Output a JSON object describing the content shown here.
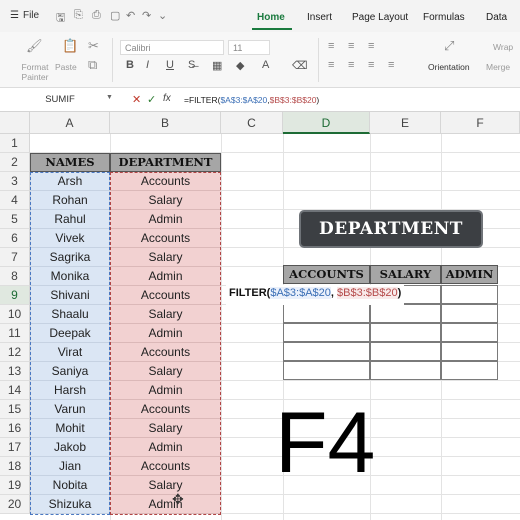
{
  "menu": {
    "file": "File",
    "tabs": [
      "Home",
      "Insert",
      "Page Layout",
      "Formulas",
      "Data"
    ],
    "active_tab": "Home"
  },
  "ribbon": {
    "format_painter": "Format Painter",
    "paste": "Paste",
    "font": "Calibri",
    "size": "11",
    "bold": "B",
    "italic": "I",
    "underline": "U",
    "orientation": "Orientation",
    "wrap": "Wrap",
    "merge": "Merge"
  },
  "formula_bar": {
    "name_box": "SUMIF",
    "fx": "fx",
    "formula_prefix": "=FILTER(",
    "formula_rangeA": "$A$3:$A$20",
    "formula_comma": ",",
    "formula_rangeB": "$B$3:$B$20",
    "formula_suffix": ")"
  },
  "columns": [
    "A",
    "B",
    "C",
    "D",
    "E",
    "F"
  ],
  "rows": [
    "1",
    "2",
    "3",
    "4",
    "5",
    "6",
    "7",
    "8",
    "9",
    "10",
    "11",
    "12",
    "13",
    "14",
    "15",
    "16",
    "17",
    "18",
    "19",
    "20"
  ],
  "table": {
    "headers": [
      "NAMES",
      "DEPARTMENT"
    ],
    "names": [
      "Arsh",
      "Rohan",
      "Rahul",
      "Vivek",
      "Sagrika",
      "Monika",
      "Shivani",
      "Shaalu",
      "Deepak",
      "Virat",
      "Saniya",
      "Harsh",
      "Varun",
      "Mohit",
      "Jakob",
      "Jian",
      "Nobita",
      "Shizuka"
    ],
    "departments": [
      "Accounts",
      "Salary",
      "Admin",
      "Accounts",
      "Salary",
      "Admin",
      "Accounts",
      "Salary",
      "Admin",
      "Accounts",
      "Salary",
      "Admin",
      "Accounts",
      "Salary",
      "Admin",
      "Accounts",
      "Salary",
      "Admin"
    ]
  },
  "banner": "DEPARTMENT",
  "output_headers": [
    "ACCOUNTS",
    "SALARY",
    "ADMIN"
  ],
  "tooltip": {
    "prefix": "FILTER(",
    "rangeA": "$A$3:$A$20",
    "comma": ",",
    "rangeB": "$B$3:$B$20",
    "suffix": ")"
  },
  "overlay_key": "F4",
  "colors": {
    "accent_green": "#1d6b35",
    "names_fill": "#dbe6f4",
    "dept_fill": "#f2d1d1",
    "header_fill": "#a6a6a6",
    "banner_fill": "#3c3f43"
  }
}
